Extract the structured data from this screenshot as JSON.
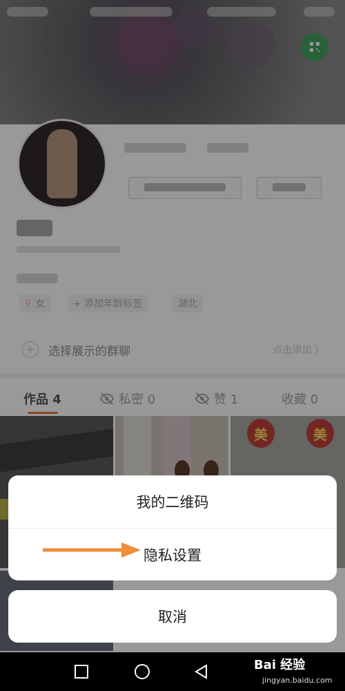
{
  "profile": {
    "gender_tag": "女",
    "age_tag": "+ 添加年龄标签",
    "location_tag": "湖北"
  },
  "group_row": {
    "label": "选择展示的群聊",
    "action": "点击添加 〉"
  },
  "tabs": [
    {
      "label": "作品 4"
    },
    {
      "label": "私密 0"
    },
    {
      "label": "赞 1"
    },
    {
      "label": "收藏 0"
    }
  ],
  "grid": {
    "lantern_char": "美"
  },
  "action_sheet": {
    "items": [
      {
        "label": "我的二维码"
      },
      {
        "label": "隐私设置"
      }
    ],
    "cancel_label": "取消"
  },
  "annotation": {
    "arrow_color": "#ee8d3a"
  },
  "watermark": {
    "brand": "Bai 经验",
    "url": "jingyan.baidu.com"
  },
  "colors": {
    "accent": "#e07a35",
    "fab": "#41a35e"
  }
}
